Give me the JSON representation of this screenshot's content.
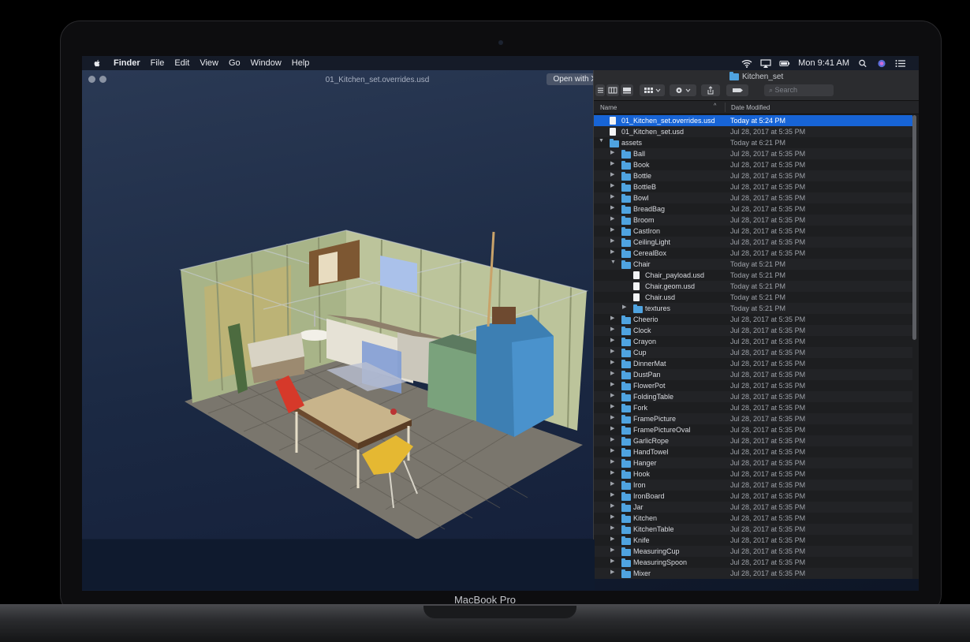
{
  "menubar": {
    "items": [
      "Finder",
      "File",
      "Edit",
      "View",
      "Go",
      "Window",
      "Help"
    ],
    "time": "Mon 9:41 AM"
  },
  "viewer": {
    "title": "01_Kitchen_set.overrides.usd",
    "open_button": "Open with Xcode-beta"
  },
  "finder": {
    "title": "Kitchen_set",
    "search_placeholder": "Search",
    "col_name": "Name",
    "col_date": "Date Modified",
    "rows": [
      {
        "name": "01_Kitchen_set.overrides.usd",
        "date": "Today at 5:24 PM",
        "level": 0,
        "kind": "file",
        "sel": true
      },
      {
        "name": "01_Kitchen_set.usd",
        "date": "Jul 28, 2017 at 5:35 PM",
        "level": 0,
        "kind": "file"
      },
      {
        "name": "assets",
        "date": "Today at 6:21 PM",
        "level": 0,
        "kind": "folder",
        "open": true
      },
      {
        "name": "Ball",
        "date": "Jul 28, 2017 at 5:35 PM",
        "level": 1,
        "kind": "folder"
      },
      {
        "name": "Book",
        "date": "Jul 28, 2017 at 5:35 PM",
        "level": 1,
        "kind": "folder"
      },
      {
        "name": "Bottle",
        "date": "Jul 28, 2017 at 5:35 PM",
        "level": 1,
        "kind": "folder"
      },
      {
        "name": "BottleB",
        "date": "Jul 28, 2017 at 5:35 PM",
        "level": 1,
        "kind": "folder"
      },
      {
        "name": "Bowl",
        "date": "Jul 28, 2017 at 5:35 PM",
        "level": 1,
        "kind": "folder"
      },
      {
        "name": "BreadBag",
        "date": "Jul 28, 2017 at 5:35 PM",
        "level": 1,
        "kind": "folder"
      },
      {
        "name": "Broom",
        "date": "Jul 28, 2017 at 5:35 PM",
        "level": 1,
        "kind": "folder"
      },
      {
        "name": "CastIron",
        "date": "Jul 28, 2017 at 5:35 PM",
        "level": 1,
        "kind": "folder"
      },
      {
        "name": "CeilingLight",
        "date": "Jul 28, 2017 at 5:35 PM",
        "level": 1,
        "kind": "folder"
      },
      {
        "name": "CerealBox",
        "date": "Jul 28, 2017 at 5:35 PM",
        "level": 1,
        "kind": "folder"
      },
      {
        "name": "Chair",
        "date": "Today at 5:21 PM",
        "level": 1,
        "kind": "folder",
        "open": true
      },
      {
        "name": "Chair_payload.usd",
        "date": "Today at 5:21 PM",
        "level": 2,
        "kind": "file"
      },
      {
        "name": "Chair.geom.usd",
        "date": "Today at 5:21 PM",
        "level": 2,
        "kind": "file"
      },
      {
        "name": "Chair.usd",
        "date": "Today at 5:21 PM",
        "level": 2,
        "kind": "file"
      },
      {
        "name": "textures",
        "date": "Today at 5:21 PM",
        "level": 2,
        "kind": "folder"
      },
      {
        "name": "Cheerio",
        "date": "Jul 28, 2017 at 5:35 PM",
        "level": 1,
        "kind": "folder"
      },
      {
        "name": "Clock",
        "date": "Jul 28, 2017 at 5:35 PM",
        "level": 1,
        "kind": "folder"
      },
      {
        "name": "Crayon",
        "date": "Jul 28, 2017 at 5:35 PM",
        "level": 1,
        "kind": "folder"
      },
      {
        "name": "Cup",
        "date": "Jul 28, 2017 at 5:35 PM",
        "level": 1,
        "kind": "folder"
      },
      {
        "name": "DinnerMat",
        "date": "Jul 28, 2017 at 5:35 PM",
        "level": 1,
        "kind": "folder"
      },
      {
        "name": "DustPan",
        "date": "Jul 28, 2017 at 5:35 PM",
        "level": 1,
        "kind": "folder"
      },
      {
        "name": "FlowerPot",
        "date": "Jul 28, 2017 at 5:35 PM",
        "level": 1,
        "kind": "folder"
      },
      {
        "name": "FoldingTable",
        "date": "Jul 28, 2017 at 5:35 PM",
        "level": 1,
        "kind": "folder"
      },
      {
        "name": "Fork",
        "date": "Jul 28, 2017 at 5:35 PM",
        "level": 1,
        "kind": "folder"
      },
      {
        "name": "FramePicture",
        "date": "Jul 28, 2017 at 5:35 PM",
        "level": 1,
        "kind": "folder"
      },
      {
        "name": "FramePictureOval",
        "date": "Jul 28, 2017 at 5:35 PM",
        "level": 1,
        "kind": "folder"
      },
      {
        "name": "GarlicRope",
        "date": "Jul 28, 2017 at 5:35 PM",
        "level": 1,
        "kind": "folder"
      },
      {
        "name": "HandTowel",
        "date": "Jul 28, 2017 at 5:35 PM",
        "level": 1,
        "kind": "folder"
      },
      {
        "name": "Hanger",
        "date": "Jul 28, 2017 at 5:35 PM",
        "level": 1,
        "kind": "folder"
      },
      {
        "name": "Hook",
        "date": "Jul 28, 2017 at 5:35 PM",
        "level": 1,
        "kind": "folder"
      },
      {
        "name": "Iron",
        "date": "Jul 28, 2017 at 5:35 PM",
        "level": 1,
        "kind": "folder"
      },
      {
        "name": "IronBoard",
        "date": "Jul 28, 2017 at 5:35 PM",
        "level": 1,
        "kind": "folder"
      },
      {
        "name": "Jar",
        "date": "Jul 28, 2017 at 5:35 PM",
        "level": 1,
        "kind": "folder"
      },
      {
        "name": "Kitchen",
        "date": "Jul 28, 2017 at 5:35 PM",
        "level": 1,
        "kind": "folder"
      },
      {
        "name": "KitchenTable",
        "date": "Jul 28, 2017 at 5:35 PM",
        "level": 1,
        "kind": "folder"
      },
      {
        "name": "Knife",
        "date": "Jul 28, 2017 at 5:35 PM",
        "level": 1,
        "kind": "folder"
      },
      {
        "name": "MeasuringCup",
        "date": "Jul 28, 2017 at 5:35 PM",
        "level": 1,
        "kind": "folder"
      },
      {
        "name": "MeasuringSpoon",
        "date": "Jul 28, 2017 at 5:35 PM",
        "level": 1,
        "kind": "folder"
      },
      {
        "name": "Mixer",
        "date": "Jul 28, 2017 at 5:35 PM",
        "level": 1,
        "kind": "folder"
      }
    ]
  },
  "device": {
    "brand": "MacBook Pro"
  }
}
